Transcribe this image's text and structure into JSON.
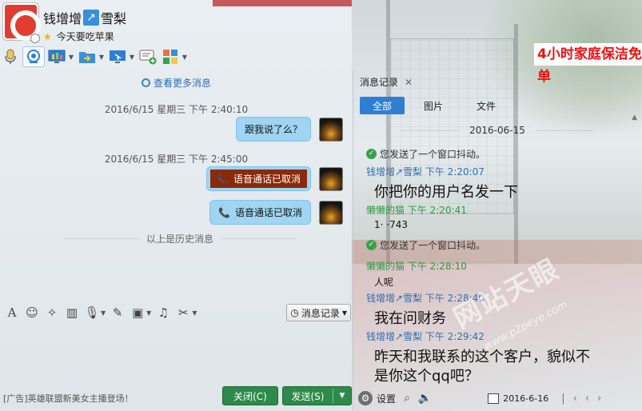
{
  "header": {
    "contact_name": "钱增增",
    "contact_remark": "雪梨",
    "status": "今天要吃苹果",
    "ad_text": "4小时家庭保洁免单"
  },
  "toolbar": {
    "items": [
      "voice-call",
      "video-call",
      "screen-share",
      "file-transfer",
      "remote-assist",
      "create-group",
      "app-center"
    ]
  },
  "chat": {
    "more_messages": "查看更多消息",
    "time1": "2016/6/15 星期三 下午 2:40:10",
    "msg1": "跟我说了么？",
    "time2": "2016/6/15 星期三 下午 2:45:00",
    "call1": "语音通话已取消",
    "call2": "语音通话已取消",
    "history_divider": "以上是历史消息"
  },
  "input": {
    "history_button": "消息记录"
  },
  "footer": {
    "ad": "[广告]英雄联盟新美女主播登场！",
    "close": "关闭(C)",
    "send": "发送(S)"
  },
  "panel": {
    "tab_label": "消息记录",
    "filters": [
      "全部",
      "图片",
      "文件"
    ],
    "date": "2016-06-15",
    "entries": {
      "shake1": "您发送了一个窗口抖动。",
      "sender1": "钱增增↗雪梨 下午 2:20:07",
      "text1": "你把你的用户名发一下",
      "sender2": "懒懒的猫 下午 2:20:41",
      "text2": "1·  ·743",
      "shake2": "您发送了一个窗口抖动。",
      "sender3": "懒懒的猫 下午 2:28:10",
      "text3": "人呢",
      "sender4": "钱增增↗雪梨 下午 2:28:40",
      "text4": "我在问财务",
      "sender5": "钱增增↗雪梨 下午 2:29:42",
      "text5a": "昨天和我联系的这个客户，貌似不",
      "text5b": "是你这个qq吧？"
    },
    "footer": {
      "settings": "设置",
      "date": "2016-6-16"
    }
  },
  "watermark": {
    "text": "网站天眼",
    "url": "www.p2peye.com"
  }
}
